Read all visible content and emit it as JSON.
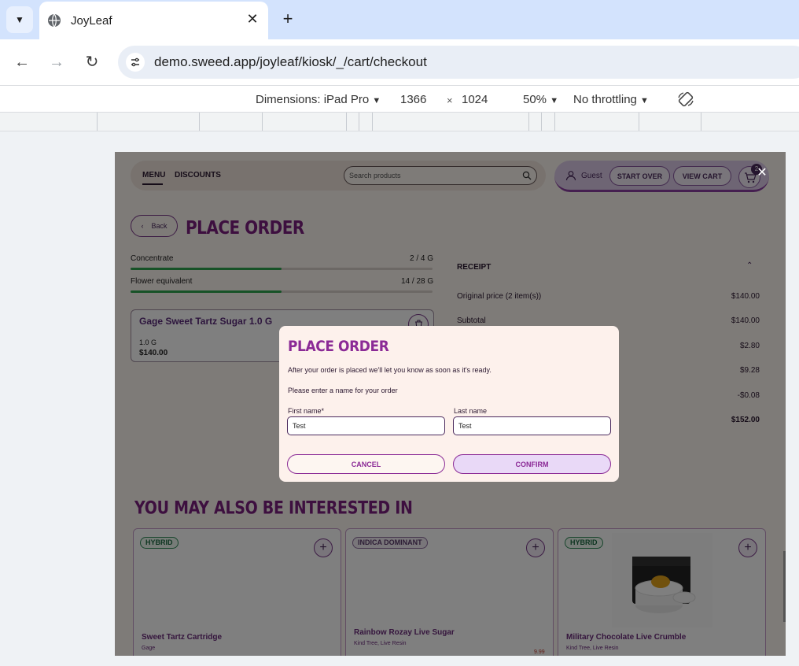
{
  "browser": {
    "tab_title": "JoyLeaf",
    "url": "demo.sweed.app/joyleaf/kiosk/_/cart/checkout"
  },
  "devtools": {
    "dimensions_label": "Dimensions: iPad Pro",
    "width": "1366",
    "times": "×",
    "height": "1024",
    "zoom": "50%",
    "throttling": "No throttling"
  },
  "header": {
    "menu": "MENU",
    "discounts": "DISCOUNTS",
    "search_placeholder": "Search products",
    "guest": "Guest",
    "start_over": "START OVER",
    "view_cart": "VIEW CART",
    "cart_count": "2"
  },
  "page": {
    "back": "Back",
    "title": "PLACE ORDER"
  },
  "limits": [
    {
      "label": "Concentrate",
      "value": "2 / 4 G",
      "fill": 0.5
    },
    {
      "label": "Flower equivalent",
      "value": "14 / 28 G",
      "fill": 0.5
    }
  ],
  "cart_item": {
    "name": "Gage Sweet Tartz Sugar 1.0 G",
    "weight": "1.0 G",
    "price": "$140.00"
  },
  "receipt": {
    "title": "RECEIPT",
    "rows": [
      {
        "label": "Original price (2 item(s))",
        "value": "$140.00"
      },
      {
        "label": "Subtotal",
        "value": "$140.00"
      },
      {
        "label": "",
        "value": "$2.80"
      },
      {
        "label": "",
        "value": "$9.28"
      },
      {
        "label": "",
        "value": "-$0.08"
      },
      {
        "label": "",
        "value": "$152.00"
      }
    ]
  },
  "recommendations": {
    "title": "YOU MAY ALSO BE INTERESTED IN",
    "products": [
      {
        "badge": "HYBRID",
        "name": "Sweet Tartz Cartridge",
        "sub": "Gage",
        "price": ""
      },
      {
        "badge": "INDICA DOMINANT",
        "name": "Rainbow Rozay Live Sugar",
        "sub": "Kind Tree, Live Resin",
        "price": "9.99"
      },
      {
        "badge": "HYBRID",
        "name": "Military Chocolate Live Crumble",
        "sub": "Kind Tree, Live Resin",
        "price": ""
      }
    ]
  },
  "modal": {
    "title": "PLACE ORDER",
    "text1": "After your order is placed we'll let you know as soon as it's ready.",
    "text2": "Please enter a name for your order",
    "first_name_label": "First name*",
    "first_name_value": "Test",
    "last_name_label": "Last name",
    "last_name_value": "Test",
    "cancel": "CANCEL",
    "confirm": "CONFIRM"
  },
  "colors": {
    "brand_purple": "#7b1e7f",
    "accent_green": "#2ea44f",
    "modal_bg": "#fdf1ec"
  },
  "icons": [
    "chevron-down-icon",
    "globe-icon",
    "close-icon",
    "plus-icon",
    "back-arrow-icon",
    "forward-arrow-icon",
    "reload-icon",
    "site-settings-icon",
    "dropdown-caret-icon",
    "rotate-icon",
    "search-icon",
    "user-icon",
    "cart-icon",
    "trash-icon",
    "chevron-up-icon"
  ]
}
